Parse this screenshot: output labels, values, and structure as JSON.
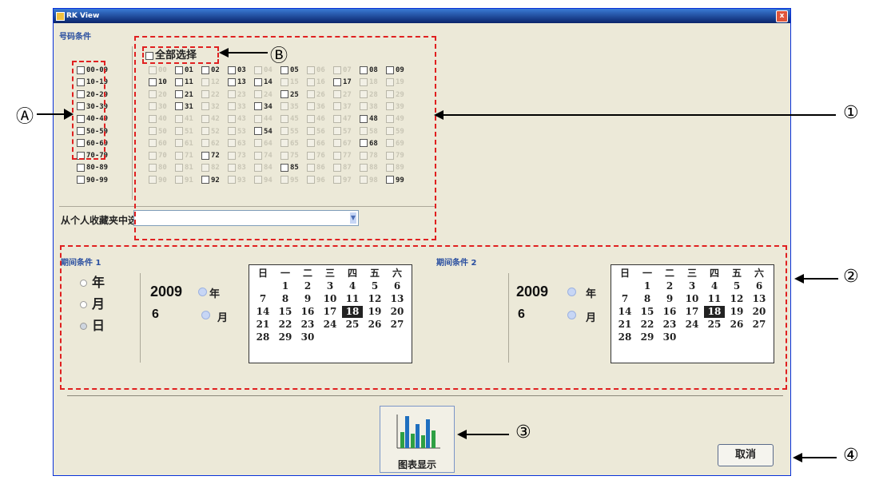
{
  "window": {
    "title": "RK View",
    "close_glyph": "x"
  },
  "number_group": {
    "title": "号码条件",
    "ranges": [
      "00-09",
      "10-19",
      "20-29",
      "30-39",
      "40-49",
      "50-59",
      "60-69",
      "70-79",
      "80-89",
      "90-99"
    ],
    "select_all": "全部选择",
    "grid_rows": [
      [
        "00",
        "01",
        "02",
        "03",
        "04",
        "05",
        "06",
        "07",
        "08",
        "09"
      ],
      [
        "10",
        "11",
        "12",
        "13",
        "14",
        "15",
        "16",
        "17",
        "18",
        "19"
      ],
      [
        "20",
        "21",
        "22",
        "23",
        "24",
        "25",
        "26",
        "27",
        "28",
        "29"
      ],
      [
        "30",
        "31",
        "32",
        "33",
        "34",
        "35",
        "36",
        "37",
        "38",
        "39"
      ],
      [
        "40",
        "41",
        "42",
        "43",
        "44",
        "45",
        "46",
        "47",
        "48",
        "49"
      ],
      [
        "50",
        "51",
        "52",
        "53",
        "54",
        "55",
        "56",
        "57",
        "58",
        "59"
      ],
      [
        "60",
        "61",
        "62",
        "63",
        "64",
        "65",
        "66",
        "67",
        "68",
        "69"
      ],
      [
        "70",
        "71",
        "72",
        "73",
        "74",
        "75",
        "76",
        "77",
        "78",
        "79"
      ],
      [
        "80",
        "81",
        "82",
        "83",
        "84",
        "85",
        "86",
        "87",
        "88",
        "89"
      ],
      [
        "90",
        "91",
        "92",
        "93",
        "94",
        "95",
        "96",
        "97",
        "98",
        "99"
      ]
    ],
    "visible_cells": [
      "01",
      "02",
      "03",
      "05",
      "08",
      "09",
      "10",
      "11",
      "13",
      "14",
      "17",
      "21",
      "25",
      "31",
      "34",
      "48",
      "54",
      "68",
      "72",
      "85",
      "92",
      "99"
    ],
    "favorite_label": "从个人收藏夹中选择",
    "favorite_value": ""
  },
  "period1": {
    "title": "期间条件 1",
    "radios": [
      {
        "label": "年",
        "selected": false
      },
      {
        "label": "月",
        "selected": false
      },
      {
        "label": "日",
        "selected": true
      }
    ],
    "year_value": "2009",
    "year_unit": "年",
    "month_value": "6",
    "month_unit": "月"
  },
  "period2": {
    "title": "期间条件 2",
    "year_value": "2009",
    "year_unit": "年",
    "month_value": "6",
    "month_unit": "月"
  },
  "calendar": {
    "weekdays": [
      "日",
      "一",
      "二",
      "三",
      "四",
      "五",
      "六"
    ],
    "weeks": [
      [
        "",
        "1",
        "2",
        "3",
        "4",
        "5",
        "6"
      ],
      [
        "7",
        "8",
        "9",
        "10",
        "11",
        "12",
        "13"
      ],
      [
        "14",
        "15",
        "16",
        "17",
        "18",
        "19",
        "20"
      ],
      [
        "21",
        "22",
        "23",
        "24",
        "25",
        "26",
        "27"
      ],
      [
        "28",
        "29",
        "30",
        "",
        "",
        "",
        ""
      ]
    ],
    "selected_day": "18"
  },
  "buttons": {
    "chart_label": "图表显示",
    "cancel_label": "取消"
  },
  "callouts": {
    "a": "Ⓐ",
    "b": "Ⓑ",
    "one": "①",
    "two": "②",
    "three": "③",
    "four": "④"
  },
  "colors": {
    "accent": "#2a4fa0",
    "annotation": "#e02020",
    "window_bg": "#ece9d8",
    "chart_bar": "#1f6fbf",
    "chart_bar_2": "#2ea043"
  }
}
